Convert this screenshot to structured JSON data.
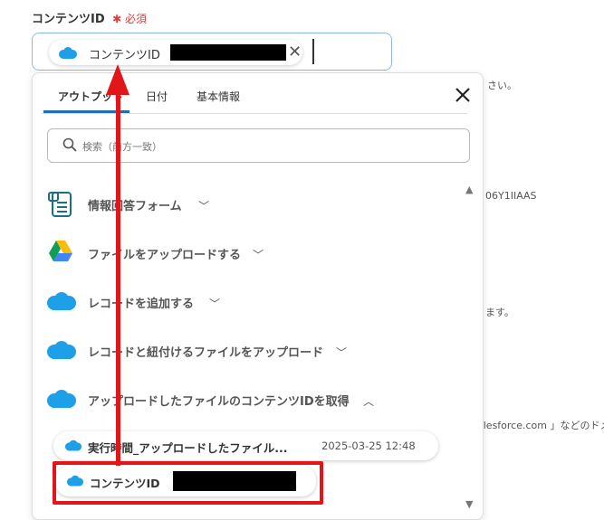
{
  "field": {
    "label": "コンテンツID",
    "required": "必須"
  },
  "input": {
    "chip_label": "コンテンツID"
  },
  "background_texts": [
    "さい。",
    "06Y1IIAAS",
    "ます。",
    "alesforce.com 」などのドメ"
  ],
  "tabs": [
    {
      "label": "アウトプット",
      "active": true
    },
    {
      "label": "日付"
    },
    {
      "label": "基本情報"
    }
  ],
  "search": {
    "placeholder": "検索（前方一致）"
  },
  "sections": [
    {
      "label": "情報回答フォーム",
      "icon": "form-icon"
    },
    {
      "label": "ファイルをアップロードする",
      "icon": "google-drive-icon"
    },
    {
      "label": "レコードを追加する",
      "icon": "salesforce-icon"
    },
    {
      "label": "レコードと紐付けるファイルをアップロード",
      "icon": "salesforce-icon"
    },
    {
      "label": "アップロードしたファイルのコンテンツIDを取得",
      "icon": "salesforce-icon",
      "expanded": true
    }
  ],
  "output_items": [
    {
      "name": "実行時間_アップロードしたファイル...",
      "value": "2025-03-25 12:48"
    },
    {
      "name": "コンテンツID",
      "value": ""
    }
  ],
  "colors": {
    "accent": "#1e6fb3",
    "annotation": "#e0161b",
    "salesforce": "#1ea0e8"
  }
}
